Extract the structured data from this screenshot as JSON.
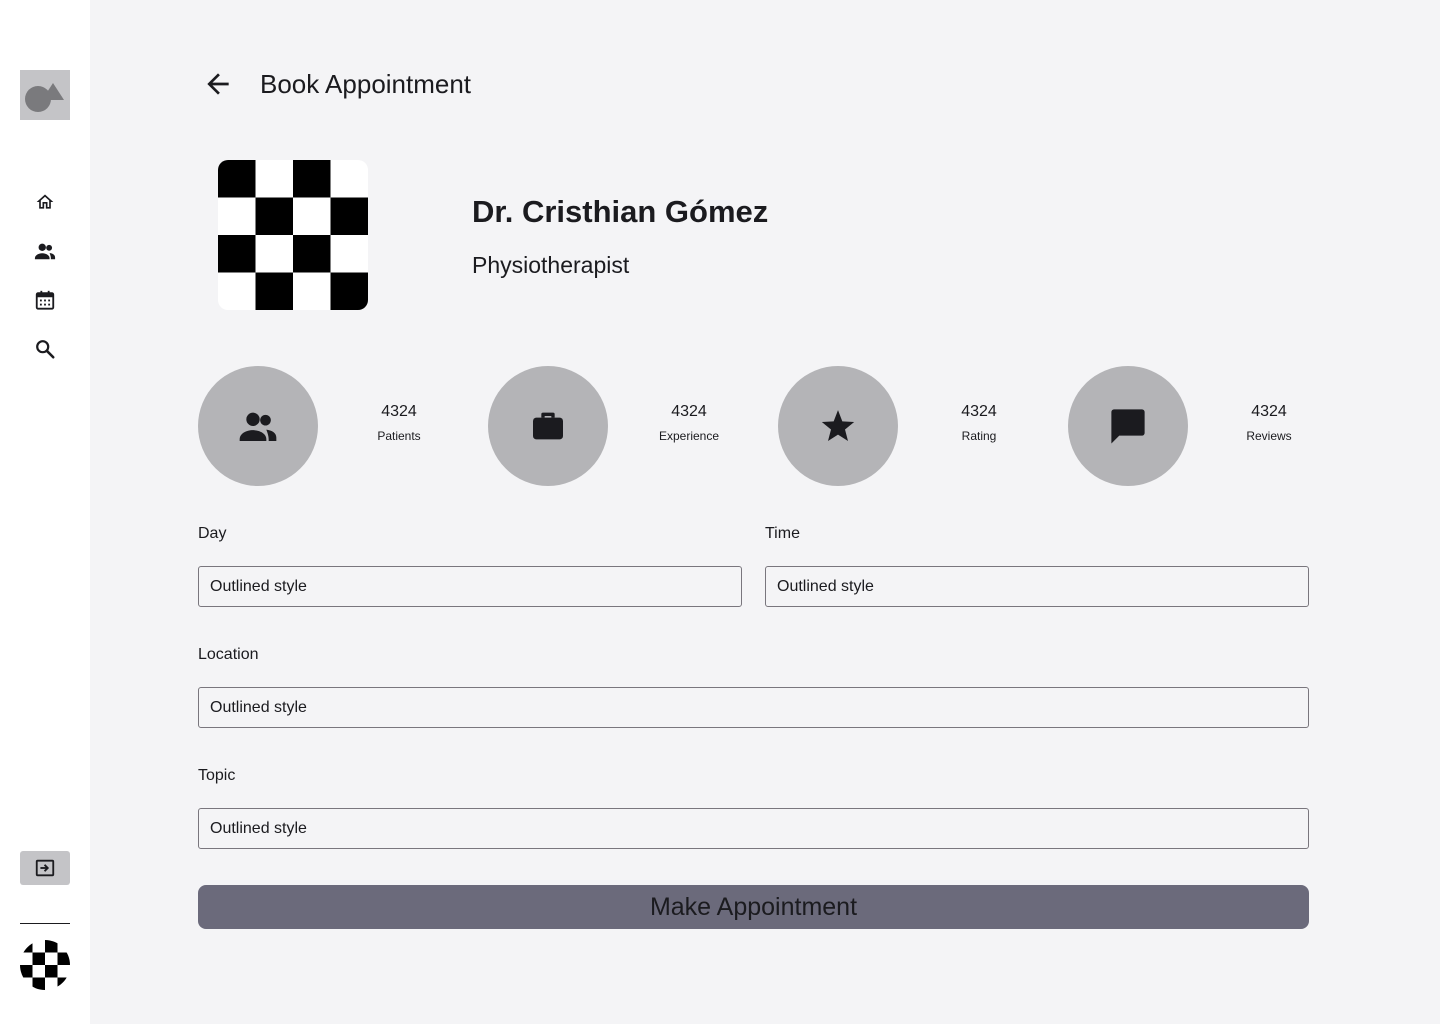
{
  "header": {
    "title": "Book Appointment"
  },
  "doctor": {
    "name": "Dr. Cristhian Gómez",
    "specialty": "Physiotherapist"
  },
  "stats": [
    {
      "value": "4324",
      "label": "Patients",
      "icon": "group-icon"
    },
    {
      "value": "4324",
      "label": "Experience",
      "icon": "briefcase-icon"
    },
    {
      "value": "4324",
      "label": "Rating",
      "icon": "star-icon"
    },
    {
      "value": "4324",
      "label": "Reviews",
      "icon": "chat-icon"
    }
  ],
  "form": {
    "day": {
      "label": "Day",
      "placeholder": "Outlined style"
    },
    "time": {
      "label": "Time",
      "placeholder": "Outlined style"
    },
    "location": {
      "label": "Location",
      "placeholder": "Outlined style"
    },
    "topic": {
      "label": "Topic",
      "placeholder": "Outlined style"
    },
    "submit_label": "Make Appointment"
  },
  "sidebar": {
    "nav": [
      {
        "icon": "home-icon"
      },
      {
        "icon": "people-icon"
      },
      {
        "icon": "calendar-icon"
      },
      {
        "icon": "search-icon"
      }
    ],
    "logout_icon": "logout-icon"
  },
  "colors": {
    "background": "#f4f4f6",
    "sidebar": "#ffffff",
    "stat_circle": "#b4b4b7",
    "button": "#6b6a7b",
    "input_border": "#79767d"
  }
}
